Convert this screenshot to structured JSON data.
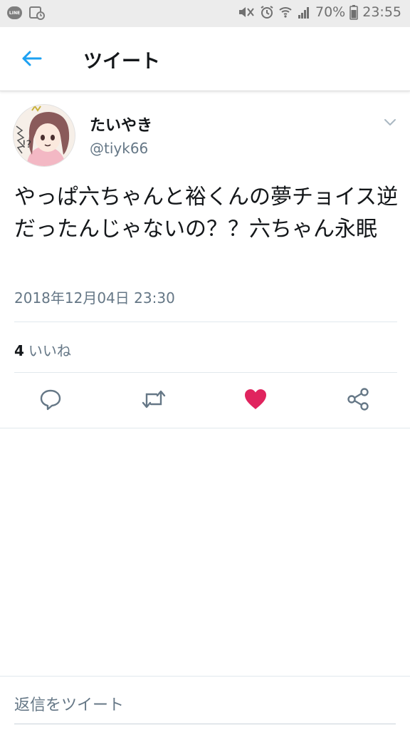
{
  "status_bar": {
    "battery_percent": "70%",
    "time": "23:55",
    "line_label": "LINE"
  },
  "header": {
    "title": "ツイート"
  },
  "tweet": {
    "display_name": "たいやき",
    "handle": "@tiyk66",
    "text": "やっぱ六ちゃんと裕くんの夢チョイス逆だったんじゃないの？？六ちゃん永眠",
    "timestamp": "2018年12月04日 23:30",
    "likes_count": "4",
    "likes_label": "いいね",
    "liked": true
  },
  "reply": {
    "placeholder": "返信をツイート"
  },
  "colors": {
    "accent": "#1da1f2",
    "like": "#e0245e",
    "secondary_text": "#657786",
    "icon_gray": "#657786"
  },
  "icons": {
    "back": "arrow-left-icon",
    "more": "chevron-down-icon",
    "reply": "speech-bubble-icon",
    "retweet": "retweet-icon",
    "like": "heart-icon",
    "share": "share-icon"
  }
}
